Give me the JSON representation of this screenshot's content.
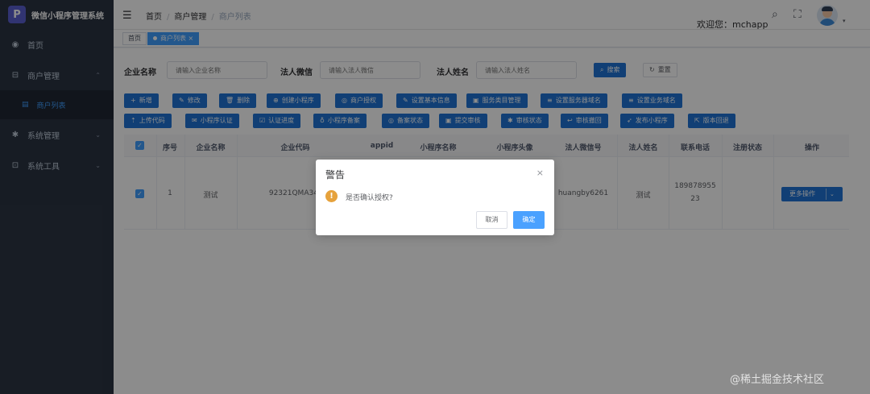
{
  "app": {
    "title": "微信小程序管理系统",
    "logo_glyph": "P"
  },
  "sidebar": {
    "items": [
      {
        "label": "首页",
        "icon": "dashboard-icon",
        "glyph": "◉"
      },
      {
        "label": "商户管理",
        "icon": "store-icon",
        "glyph": "⊟"
      },
      {
        "label": "商户列表",
        "icon": "list-icon",
        "glyph": "▤"
      },
      {
        "label": "系统管理",
        "icon": "gear-icon",
        "glyph": "✱"
      },
      {
        "label": "系统工具",
        "icon": "toolbox-icon",
        "glyph": "⊡"
      }
    ],
    "chevron": "⌃",
    "chevron_down": "⌄"
  },
  "header": {
    "breadcrumb": [
      "首页",
      "商户管理",
      "商户列表"
    ],
    "welcome": "欢迎您：mchapp",
    "search_icon": "⌕",
    "fullscreen_icon": "⛶",
    "caret": "▾"
  },
  "tags": [
    {
      "label": "首页"
    },
    {
      "label": "商户列表",
      "close": "×"
    }
  ],
  "search_form": {
    "company_label": "企业名称",
    "company_placeholder": "请输入企业名称",
    "wechat_label": "法人微信",
    "wechat_placeholder": "请输入法人微信",
    "person_label": "法人姓名",
    "person_placeholder": "请输入法人姓名",
    "search_button": "搜索",
    "reset_button": "重置"
  },
  "toolbar_row1": [
    {
      "label": "新增",
      "glyph": "+"
    },
    {
      "label": "修改",
      "glyph": "✎"
    },
    {
      "label": "删除",
      "glyph": "🗑"
    },
    {
      "label": "创建小程序",
      "glyph": "⊕"
    },
    {
      "label": "商户授权",
      "glyph": "◎"
    },
    {
      "label": "设置基本信息",
      "glyph": "✎"
    },
    {
      "label": "服务类目管理",
      "glyph": "▣"
    },
    {
      "label": "设置服务器域名",
      "glyph": "≡"
    },
    {
      "label": "设置业务域名",
      "glyph": "≡"
    }
  ],
  "toolbar_row2": [
    {
      "label": "上传代码",
      "glyph": "⇡"
    },
    {
      "label": "小程序认证",
      "glyph": "✉"
    },
    {
      "label": "认证进度",
      "glyph": "☑"
    },
    {
      "label": "小程序备案",
      "glyph": "♁"
    },
    {
      "label": "备案状态",
      "glyph": "◎"
    },
    {
      "label": "提交审核",
      "glyph": "▣"
    },
    {
      "label": "审核状态",
      "glyph": "✱"
    },
    {
      "label": "审核撤回",
      "glyph": "↩"
    },
    {
      "label": "发布小程序",
      "glyph": "➶"
    },
    {
      "label": "版本回退",
      "glyph": "⇱"
    }
  ],
  "table": {
    "columns": [
      "序号",
      "企业名称",
      "企业代码",
      "appid",
      "小程序名称",
      "小程序头像",
      "法人微信号",
      "法人姓名",
      "联系电话",
      "注册状态",
      "操作"
    ],
    "rows": [
      {
        "index": "1",
        "company": "测试",
        "code": "92321QMA34M50",
        "wechat": "huangby6261",
        "person": "测试",
        "phone_line1": "189878955",
        "phone_line2": "23"
      }
    ],
    "more_actions": "更多操作",
    "checkmark": "✓"
  },
  "dialog": {
    "title": "警告",
    "message": "是否确认授权?",
    "cancel": "取消",
    "confirm": "确定",
    "close": "×",
    "warn_glyph": "!"
  },
  "watermark": "@稀土掘金技术社区"
}
